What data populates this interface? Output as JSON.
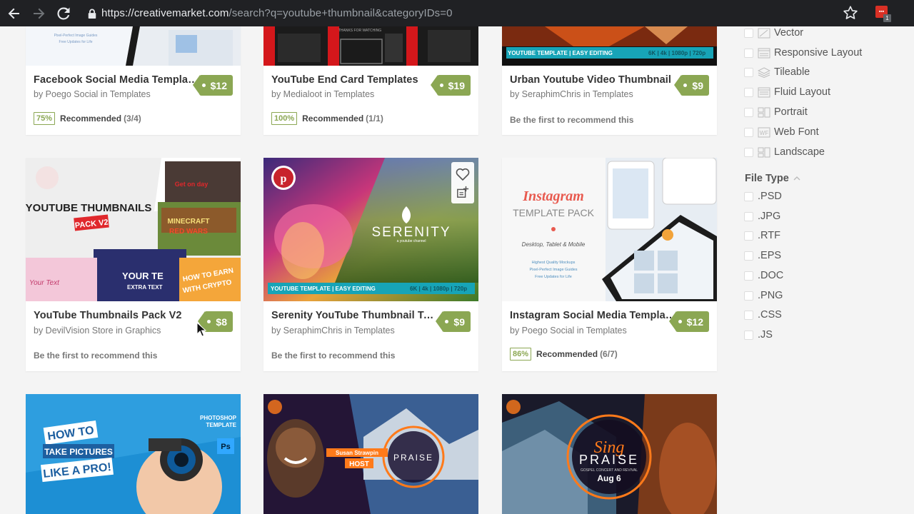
{
  "browser": {
    "url_host": "https://creativemarket.com",
    "url_rest": "/search?q=youtube+thumbnail&categoryIDs=0",
    "ext_badge": "1"
  },
  "cards": [
    {
      "title": "Facebook Social Media Template ...",
      "by": "by Poego Social in Templates",
      "price": "$12",
      "rec_pct": "75%",
      "rec_label": "Recommended",
      "rec_count": "(3/4)"
    },
    {
      "title": "YouTube End Card Templates",
      "by": "by Medialoot in Templates",
      "price": "$19",
      "rec_pct": "100%",
      "rec_label": "Recommended",
      "rec_count": "(1/1)"
    },
    {
      "title": "Urban Youtube Video Thumbnail",
      "by": "by SeraphimChris in Templates",
      "price": "$9",
      "first": "Be the first to recommend this"
    },
    {
      "title": "YouTube Thumbnails Pack V2",
      "by": "by DevilVision Store in Graphics",
      "price": "$8",
      "first": "Be the first to recommend this"
    },
    {
      "title": "Serenity YouTube Thumbnail Tem...",
      "by": "by SeraphimChris in Templates",
      "price": "$9",
      "first": "Be the first to recommend this"
    },
    {
      "title": "Instagram Social Media Template ...",
      "by": "by Poego Social in Templates",
      "price": "$12",
      "rec_pct": "86%",
      "rec_label": "Recommended",
      "rec_count": "(6/7)"
    }
  ],
  "thumb_text": {
    "fb_lines": [
      "Pixel-Perfect Image Guides",
      "Free Updates for Life"
    ],
    "urban_bar": "YOUTUBE TEMPLATE | EASY EDITING",
    "urban_specs": "6K | 4k | 1080p | 720p",
    "end_card_top": "THANKS FOR WATCHING",
    "ytpack_title1": "YOUTUBE THUMBNAILS",
    "ytpack_title2": "PACK V2",
    "ytpack_a": "Get on day",
    "ytpack_b": "MINECRAFT",
    "ytpack_c": "RED WARS",
    "ytpack_d": "Your Text",
    "ytpack_e": "YOUR TE",
    "ytpack_f": "EXTRA TEXT",
    "ytpack_g": "HOW TO EARN",
    "ytpack_h": "WITH CRYPTO",
    "serenity_title": "SERENITY",
    "serenity_sub": "a youtube channel",
    "serenity_bar": "YOUTUBE TEMPLATE | EASY EDITING",
    "serenity_specs": "6K | 4k | 1080p | 720p",
    "ig_title1": "Instagram",
    "ig_title2": "TEMPLATE PACK",
    "ig_sub": "Desktop, Tablet & Mobile",
    "ig_lines": [
      "Highest Quality Mockups",
      "Pixel-Perfect Image Guides",
      "Free Updates for Life"
    ],
    "photo_tag1": "PHOTOSHOP",
    "photo_tag2": "TEMPLATE",
    "photo_h1": "HOW TO",
    "photo_h2": "TAKE PICTURES",
    "photo_h3": "LIKE A PRO!",
    "host_name": "Susan Strawpin",
    "host_label": "HOST",
    "praise": "PRAISE",
    "sing": "Sing",
    "sing_praise": "PRAISE",
    "sing_sub": "GOSPEL CONCERT AND REVIVAL",
    "sing_date": "Aug 6"
  },
  "filters": {
    "types": [
      {
        "label": "Vector",
        "icon": "vector-icon"
      },
      {
        "label": "Responsive Layout",
        "icon": "responsive-layout-icon"
      },
      {
        "label": "Tileable",
        "icon": "tileable-icon"
      },
      {
        "label": "Fluid Layout",
        "icon": "fluid-layout-icon"
      },
      {
        "label": "Portrait",
        "icon": "portrait-icon"
      },
      {
        "label": "Web Font",
        "icon": "web-font-icon"
      },
      {
        "label": "Landscape",
        "icon": "landscape-icon"
      }
    ],
    "file_type_heading": "File Type",
    "file_types": [
      ".PSD",
      ".JPG",
      ".RTF",
      ".EPS",
      ".DOC",
      ".PNG",
      ".CSS",
      ".JS"
    ]
  },
  "colors": {
    "price": "#8ba753",
    "chrome": "#202124"
  }
}
